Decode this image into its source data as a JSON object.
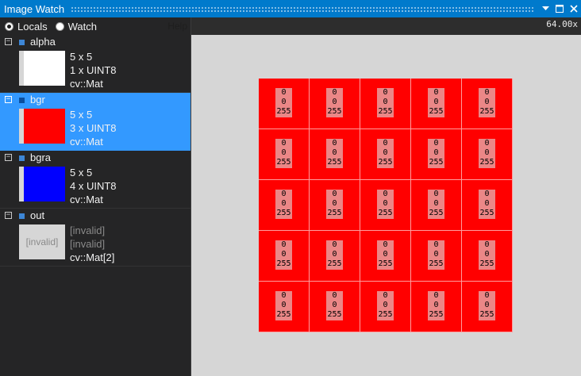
{
  "window": {
    "title": "Image Watch"
  },
  "toolbar": {
    "locals_label": "Locals",
    "watch_label": "Watch",
    "help_label": "Help"
  },
  "zoom": {
    "level": "64.00x"
  },
  "variables": [
    {
      "name": "alpha",
      "dims": "5 x 5",
      "type": "1 x UINT8",
      "class": "cv::Mat",
      "thumb_color": "#ffffff",
      "selected": false,
      "valid": true
    },
    {
      "name": "bgr",
      "dims": "5 x 5",
      "type": "3 x UINT8",
      "class": "cv::Mat",
      "thumb_color": "#ff0000",
      "selected": true,
      "valid": true
    },
    {
      "name": "bgra",
      "dims": "5 x 5",
      "type": "4 x UINT8",
      "class": "cv::Mat",
      "thumb_color": "#0000ff",
      "selected": false,
      "valid": true
    },
    {
      "name": "out",
      "dims": "[invalid]",
      "type": "[invalid]",
      "class": "cv::Mat[2]",
      "thumb_text": "[invalid]",
      "selected": false,
      "valid": false
    }
  ],
  "pixel_grid": {
    "rows": 5,
    "cols": 5,
    "fill_color": "#ff0000",
    "pixel_values": [
      "0",
      "0",
      "255"
    ]
  },
  "icons": {
    "expander": "collapse-box-icon",
    "variable": "variable-square-icon"
  }
}
